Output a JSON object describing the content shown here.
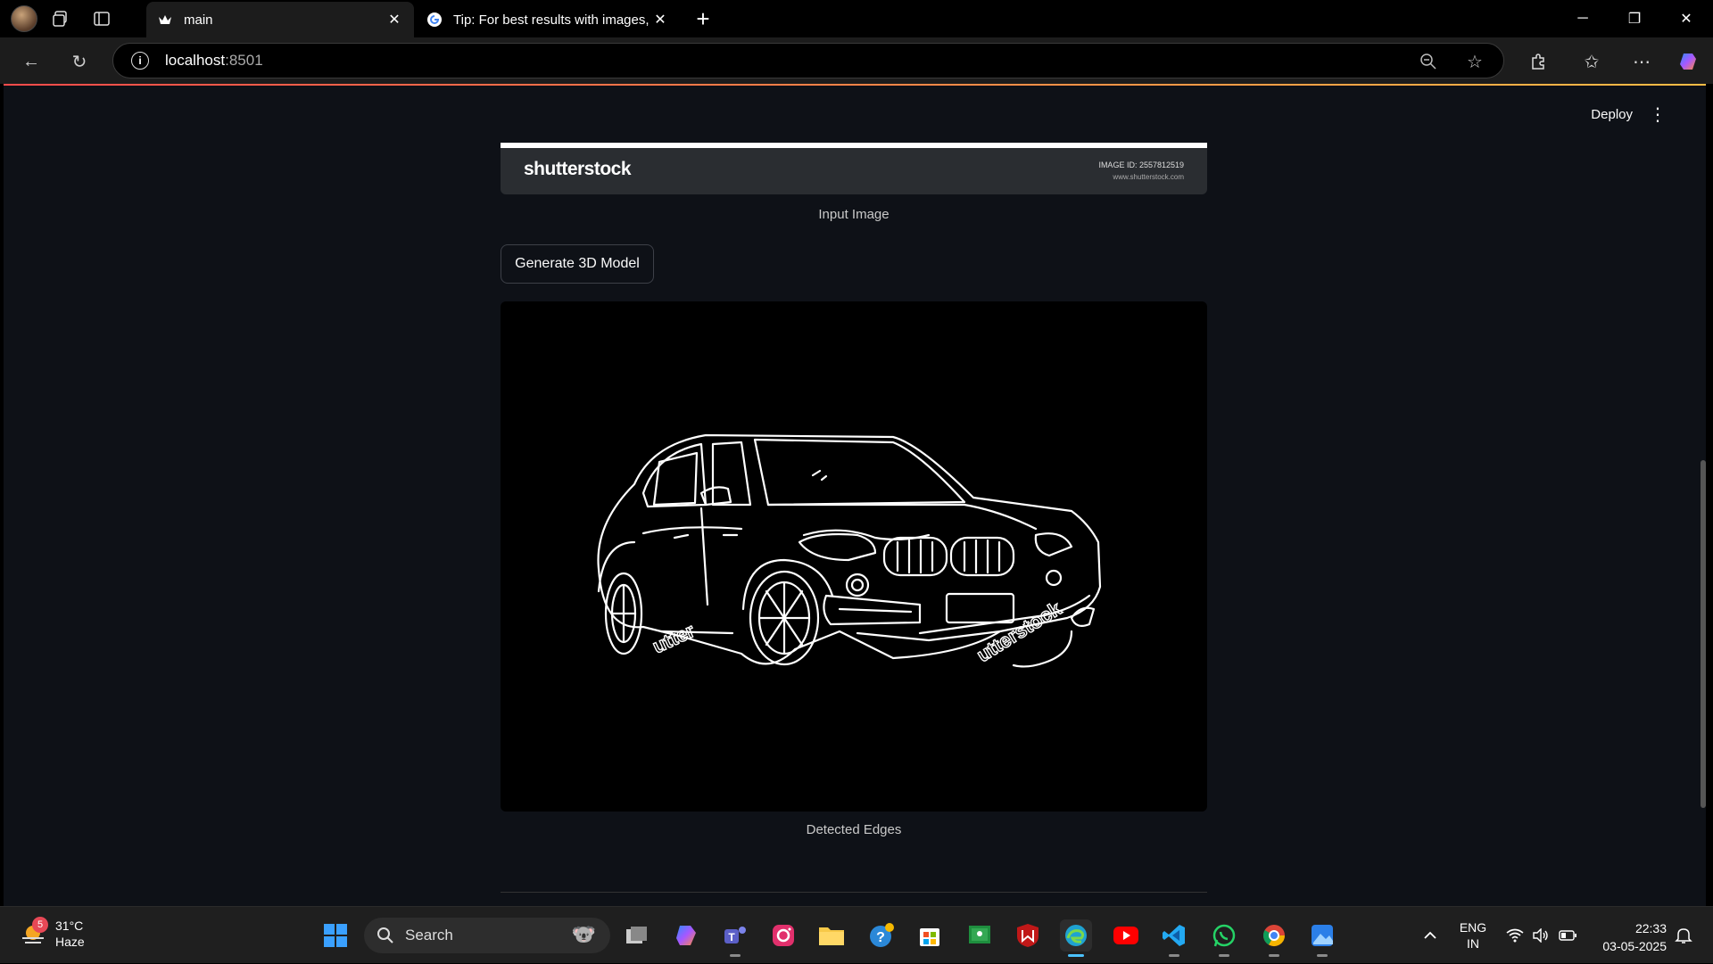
{
  "browser": {
    "tabs": [
      {
        "title": "main",
        "active": true
      },
      {
        "title": "Tip: For best results with images, c",
        "active": false
      }
    ],
    "url_host": "localhost",
    "url_port": ":8501"
  },
  "app": {
    "deploy_label": "Deploy",
    "banner": {
      "logo_text": "shutterstock",
      "image_id": "IMAGE ID: 2557812519",
      "image_url": "www.shutterstock.com"
    },
    "input_caption": "Input Image",
    "generate_button": "Generate 3D Model",
    "edges_caption": "Detected Edges",
    "watermark_left": "utter",
    "watermark_right": "utterstock"
  },
  "taskbar": {
    "weather_temp": "31°C",
    "weather_desc": "Haze",
    "weather_badge": "5",
    "search_label": "Search",
    "lang_line1": "ENG",
    "lang_line2": "IN",
    "time": "22:33",
    "date": "03-05-2025"
  },
  "colors": {
    "page_bg": "#0e1117",
    "accent_top": "#ff4b4b",
    "taskbar_bg": "#1f1f1f"
  }
}
